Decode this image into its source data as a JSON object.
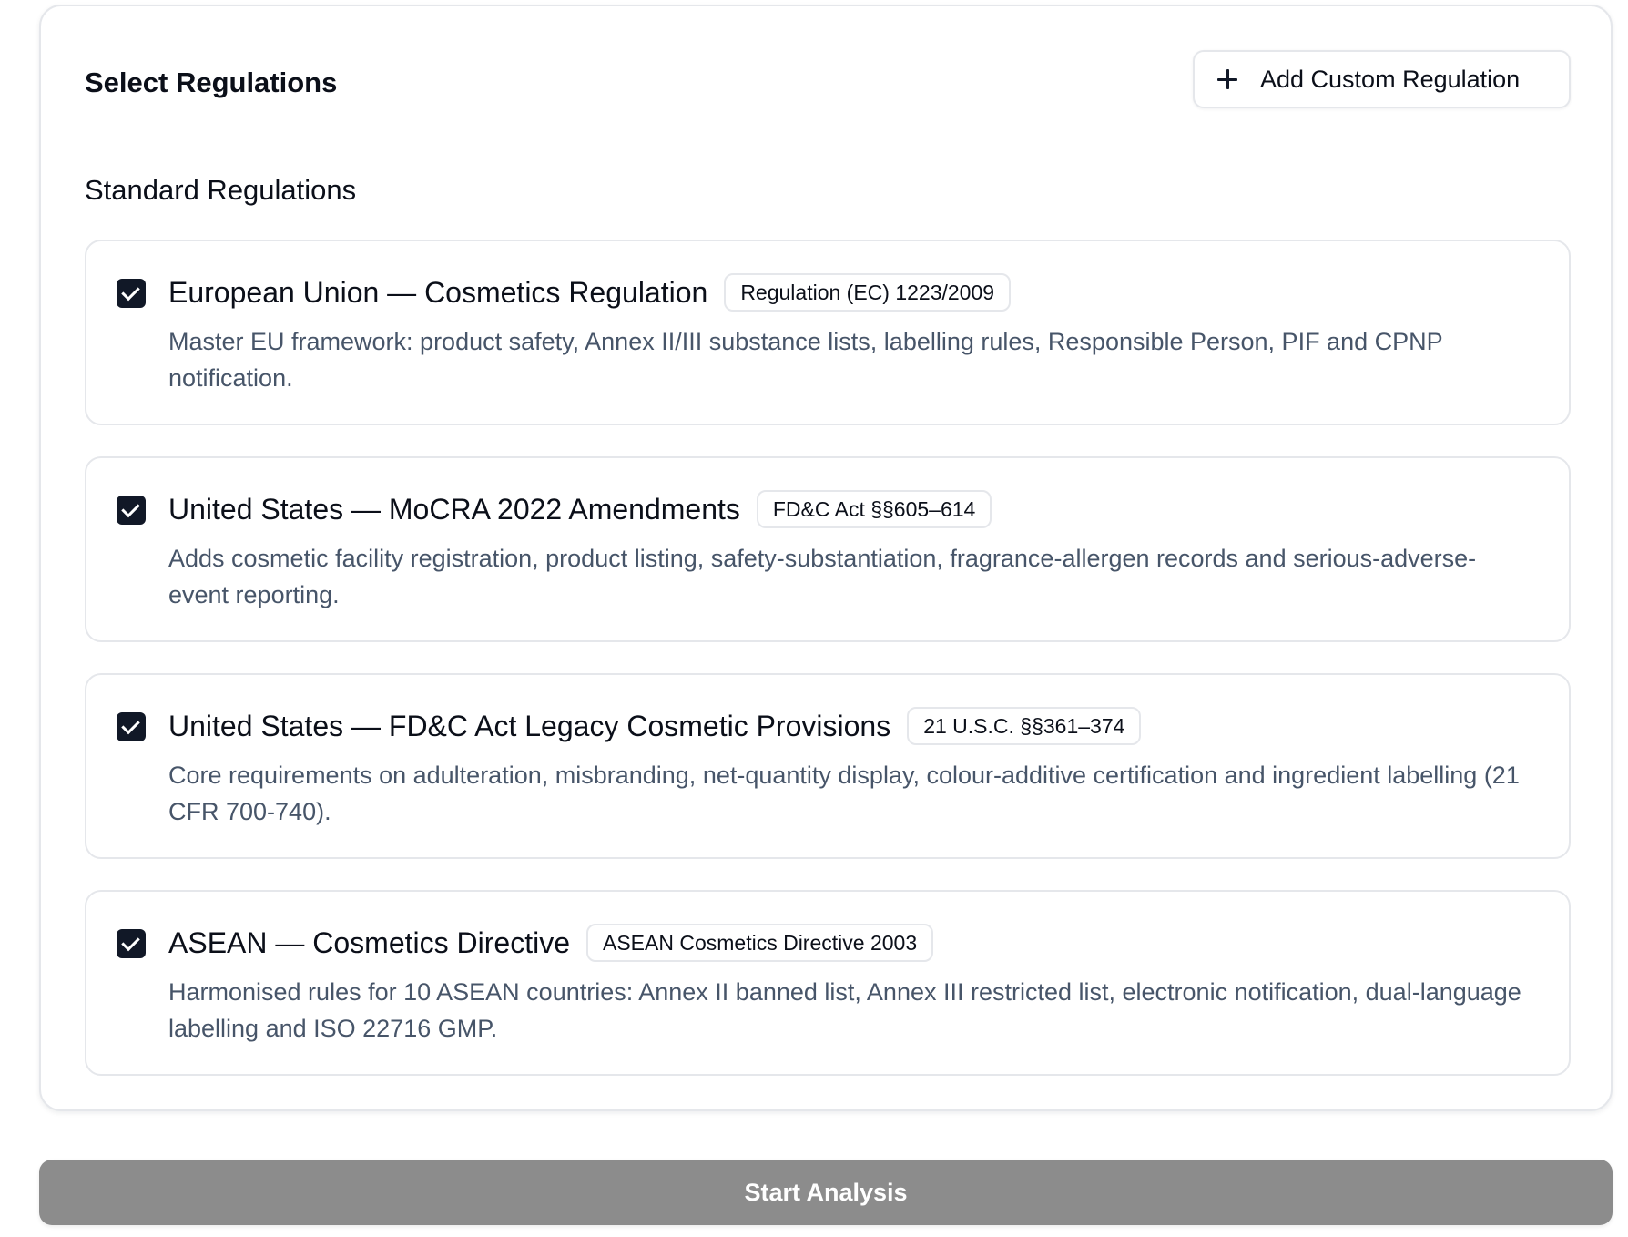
{
  "panel": {
    "title": "Select Regulations",
    "add_button_label": "Add Custom Regulation",
    "section_title": "Standard Regulations"
  },
  "regulations": [
    {
      "title": "European Union — Cosmetics Regulation",
      "badge": "Regulation (EC) 1223/2009",
      "description": "Master EU framework: product safety, Annex II/III substance lists, labelling rules, Responsible Person, PIF and CPNP notification.",
      "checked": true
    },
    {
      "title": "United States — MoCRA 2022 Amendments",
      "badge": "FD&C Act §§605–614",
      "description": "Adds cosmetic facility registration, product listing, safety-substantiation, fragrance-allergen records and serious-adverse-event reporting.",
      "checked": true
    },
    {
      "title": "United States — FD&C Act Legacy Cosmetic Provisions",
      "badge": "21 U.S.C. §§361–374",
      "description": "Core requirements on adulteration, misbranding, net-quantity display, colour-additive certification and ingredient labelling (21 CFR 700-740).",
      "checked": true
    },
    {
      "title": "ASEAN — Cosmetics Directive",
      "badge": "ASEAN Cosmetics Directive 2003",
      "description": "Harmonised rules for 10 ASEAN countries: Annex II banned list, Annex III restricted list, electronic notification, dual-language labelling and ISO 22716 GMP.",
      "checked": true
    }
  ],
  "actions": {
    "start_label": "Start Analysis"
  },
  "colors": {
    "border": "#e5e7eb",
    "checkbox": "#111827",
    "description_text": "#475569",
    "start_button_bg": "#8c8c8c"
  },
  "icons": {
    "add": "plus-icon",
    "checkbox": "check-icon"
  }
}
